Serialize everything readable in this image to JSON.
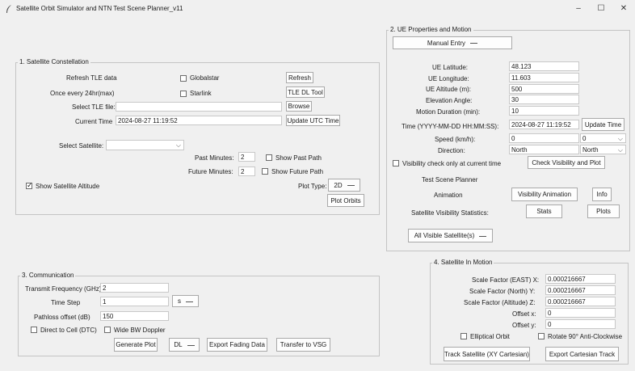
{
  "window": {
    "title": "Satellite Orbit Simulator and NTN Test Scene Planner_v11",
    "minimize": "–",
    "maximize": "☐",
    "close": "✕"
  },
  "constellation": {
    "frame_label": "1. Satellite Constellation",
    "refresh_tle_label": "Refresh TLE data",
    "once_label": "Once every 24hr(max)",
    "globalstar_label": "Globalstar",
    "starlink_label": "Starlink",
    "refresh_button": "Refresh",
    "tle_dl_tool_button": "TLE DL Tool",
    "select_tle_label": "Select TLE file:",
    "tle_file_value": "",
    "browse_button": "Browse",
    "current_time_label": "Current Time",
    "current_time_value": "2024-08-27 11:19:52",
    "update_utc_button": "Update UTC Time",
    "select_satellite_label": "Select Satellite:",
    "select_satellite_value": "",
    "past_minutes_label": "Past Minutes:",
    "past_minutes_value": "2",
    "show_past_path_label": "Show Past Path",
    "future_minutes_label": "Future Minutes:",
    "future_minutes_value": "2",
    "show_future_path_label": "Show Future Path",
    "show_altitude_label": "Show Satellite Altitude",
    "plot_type_label": "Plot Type:",
    "plot_type_value": "2D",
    "plot_orbits_button": "Plot Orbits"
  },
  "ue": {
    "frame_label": "2. UE Properties and Motion",
    "mode_value": "Manual Entry",
    "latitude_label": "UE Latitude:",
    "latitude_value": "48.123",
    "longitude_label": "UE Longitude:",
    "longitude_value": "11.603",
    "altitude_label": "UE Altitude (m):",
    "altitude_value": "500",
    "elevation_label": "Elevation Angle:",
    "elevation_value": "30",
    "motion_duration_label": "Motion Duration (min):",
    "motion_duration_value": "10",
    "time_label": "Time (YYYY-MM-DD HH:MM:SS):",
    "time_value": "2024-08-27 11:19:52",
    "update_time_button": "Update Time",
    "speed_label": "Speed (km/h):",
    "speed_value": "0",
    "speed_select_value": "0",
    "direction_label": "Direction:",
    "direction_value": "North",
    "direction_select_value": "North",
    "visibility_check_label": "Visibility check only at current time",
    "check_visibility_button": "Check Visibility and Plot",
    "test_scene_label": "Test Scene Planner",
    "animation_label": "Animation",
    "visibility_animation_button": "Visibility Animation",
    "info_button": "Info",
    "stats_label": "Satellite Visibility Statistics:",
    "stats_button": "Stats",
    "plots_button": "Plots",
    "all_visible_value": "All Visible Satellite(s)"
  },
  "communication": {
    "frame_label": "3. Communication",
    "tx_freq_label": "Transmit Frequency (GHz)",
    "tx_freq_value": "2",
    "time_step_label": "Time Step",
    "time_step_value": "1",
    "time_unit_value": "s",
    "pathloss_label": "Pathloss offset (dB)",
    "pathloss_value": "150",
    "dtc_label": "Direct to Cell (DTC)",
    "wide_bw_label": "Wide BW Doppler",
    "generate_plot_button": "Generate Plot",
    "dl_value": "DL",
    "export_fading_button": "Export Fading Data",
    "transfer_vsg_button": "Transfer to VSG"
  },
  "motion": {
    "frame_label": "4. Satellite In Motion",
    "scale_east_label": "Scale Factor (EAST) X:",
    "scale_east_value": "0.000216667",
    "scale_north_label": "Scale Factor (North) Y:",
    "scale_north_value": "0.000216667",
    "scale_alt_label": "Scale Factor (Altitude) Z:",
    "scale_alt_value": "0.000216667",
    "offset_x_label": "Offset x:",
    "offset_x_value": "0",
    "offset_y_label": "Offset y:",
    "offset_y_value": "0",
    "elliptical_label": "Elliptical Orbit",
    "rotate_label": "Rotate 90° Anti-Clockwise",
    "track_button": "Track Satellite (XY Cartesian)",
    "export_track_button": "Export Cartesian Track"
  }
}
